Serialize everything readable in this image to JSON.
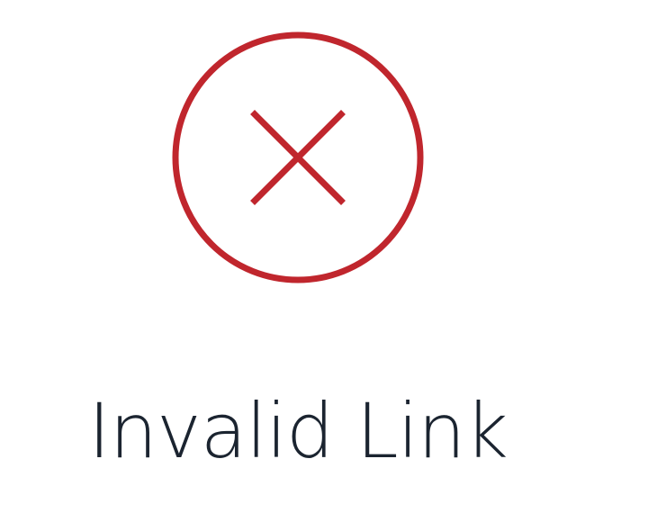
{
  "status": {
    "icon": "error-x-circle-icon",
    "title": "Invalid Link"
  },
  "colors": {
    "error": "#c0262d",
    "text": "#1b2430",
    "background": "#ffffff"
  }
}
